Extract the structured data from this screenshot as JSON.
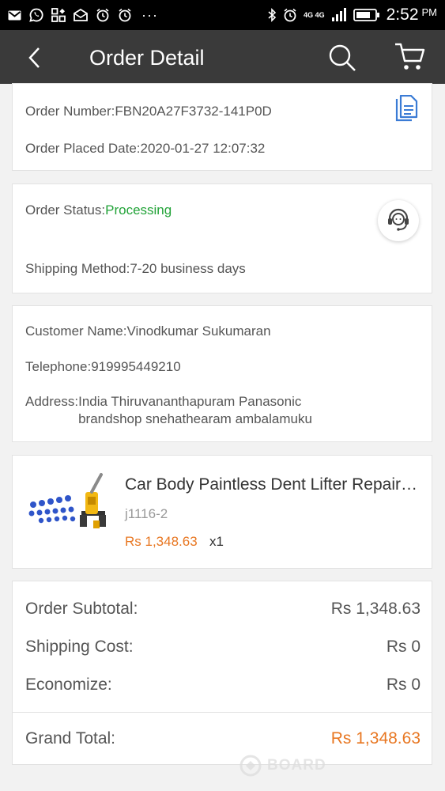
{
  "status_bar": {
    "time": "2:52",
    "am_pm": "PM",
    "network": "4G 4G",
    "icons": [
      "gmail-icon",
      "whatsapp-icon",
      "apps-icon",
      "mail-icon",
      "alarm-icon",
      "alarm-icon",
      "more-icon",
      "bluetooth-icon",
      "alarm-icon",
      "signal-icon",
      "battery-icon"
    ],
    "more": "···"
  },
  "header": {
    "title": "Order Detail",
    "icons": [
      "back-icon",
      "search-icon",
      "cart-icon"
    ]
  },
  "order_info": {
    "number_label": "Order Number:",
    "number": "FBN20A27F3732-141P0D",
    "date_label": "Order Placed Date:",
    "date": "2020-01-27 12:07:32"
  },
  "status": {
    "label": "Order Status:",
    "value": "Processing",
    "shipping_label": "Shipping Method:",
    "shipping_value": "7-20 business days"
  },
  "customer": {
    "name_label": "Customer Name:",
    "name": "Vinodkumar Sukumaran",
    "phone_label": "Telephone:",
    "phone": "919995449210",
    "address_label": "Address:",
    "address": "India Thiruvananthapuram Panasonic brandshop snehathearam ambalamuku"
  },
  "product": {
    "name": "Car Body Paintless Dent Lifter Repair Tools",
    "sku": "j1116-2",
    "price": "Rs 1,348.63",
    "qty": "x1"
  },
  "summary": {
    "subtotal_label": "Order Subtotal:",
    "subtotal": "Rs 1,348.63",
    "shipping_label": "Shipping Cost:",
    "shipping": "Rs 0",
    "economize_label": "Economize:",
    "economize": "Rs 0",
    "grand_label": "Grand Total:",
    "grand": "Rs 1,348.63"
  },
  "watermark": "BOARD",
  "colors": {
    "accent_orange": "#e87722",
    "status_green": "#22a338",
    "app_bar": "#3a3a3a",
    "icon_blue": "#3a7bd5"
  }
}
